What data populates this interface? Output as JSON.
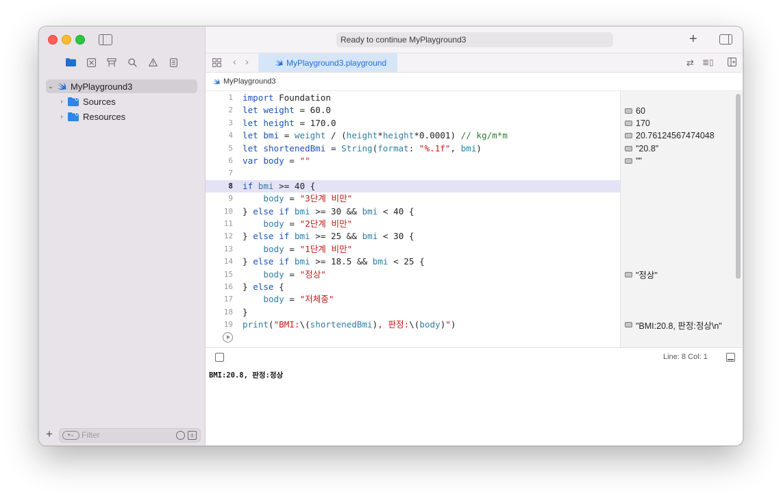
{
  "window": {
    "status_text": "Ready to continue MyPlayground3"
  },
  "sidebar": {
    "nav_icons": [
      "folder-icon",
      "source-control-icon",
      "hierarchy-icon",
      "search-icon",
      "warning-icon",
      "list-icon"
    ],
    "tree": [
      {
        "label": "MyPlayground3",
        "expanded": true,
        "selected": true
      },
      {
        "label": "Sources",
        "expanded": false
      },
      {
        "label": "Resources",
        "expanded": false
      }
    ],
    "filter_placeholder": "Filter"
  },
  "tabbar": {
    "file_tab": "MyPlayground3.playground"
  },
  "jumpbar": {
    "crumb": "MyPlayground3"
  },
  "editor": {
    "current_line": 8,
    "lines": [
      {
        "n": "1",
        "src": "import Foundation"
      },
      {
        "n": "2",
        "src": "let weight = 60.0"
      },
      {
        "n": "3",
        "src": "let height = 170.0"
      },
      {
        "n": "4",
        "src": "let bmi = weight / (height*height*0.0001) // kg/m*m"
      },
      {
        "n": "5",
        "src": "let shortenedBmi = String(format: \"%.1f\", bmi)"
      },
      {
        "n": "6",
        "src": "var body = \"\""
      },
      {
        "n": "7",
        "src": ""
      },
      {
        "n": "8",
        "src": "if bmi >= 40 {"
      },
      {
        "n": "9",
        "src": "    body = \"3단계 비만\""
      },
      {
        "n": "10",
        "src": "} else if bmi >= 30 && bmi < 40 {"
      },
      {
        "n": "11",
        "src": "    body = \"2단계 비만\""
      },
      {
        "n": "12",
        "src": "} else if bmi >= 25 && bmi < 30 {"
      },
      {
        "n": "13",
        "src": "    body = \"1단계 비만\""
      },
      {
        "n": "14",
        "src": "} else if bmi >= 18.5 && bmi < 25 {"
      },
      {
        "n": "15",
        "src": "    body = \"정상\""
      },
      {
        "n": "16",
        "src": "} else {"
      },
      {
        "n": "17",
        "src": "    body = \"저체중\""
      },
      {
        "n": "18",
        "src": "}"
      },
      {
        "n": "19",
        "src": "print(\"BMI:\\(shortenedBmi), 판정:\\(body)\")"
      }
    ]
  },
  "results": [
    {
      "line": 2,
      "text": "60"
    },
    {
      "line": 3,
      "text": "170"
    },
    {
      "line": 4,
      "text": "20.76124567474048"
    },
    {
      "line": 5,
      "text": "\"20.8\""
    },
    {
      "line": 6,
      "text": "\"\""
    },
    {
      "line": 15,
      "text": "\"정상\""
    },
    {
      "line": 19,
      "text": "\"BMI:20.8, 판정:정상\\n\""
    }
  ],
  "debugbar": {
    "line_info": "Line: 8  Col: 1"
  },
  "console": {
    "output": "BMI:20.8, 판정:정상"
  }
}
